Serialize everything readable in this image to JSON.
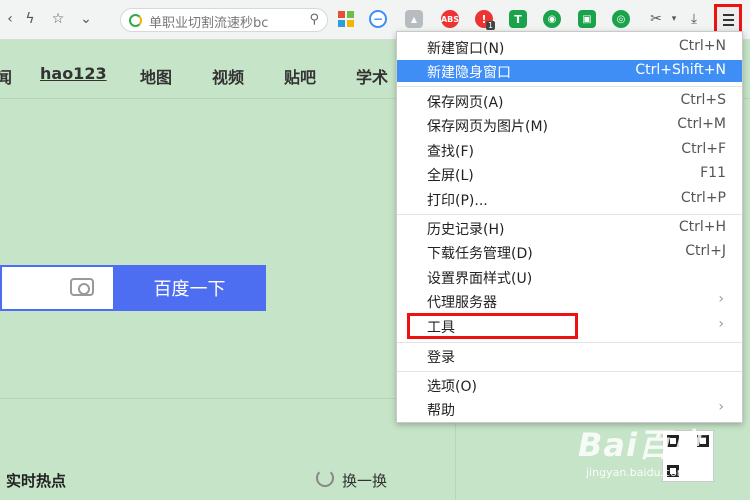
{
  "address_bar": {
    "text": "单职业切割流速秒bc"
  },
  "extensions": [
    {
      "name": "tile-grid-icon",
      "color": "#e94f35"
    },
    {
      "name": "minus-circle-icon",
      "color": "#3f8ef5"
    },
    {
      "name": "puzzle-icon",
      "color": "#9aa0a6"
    },
    {
      "name": "abs-icon",
      "label": "ABS",
      "color": "#e33"
    },
    {
      "name": "alert-icon",
      "color": "#e33",
      "badge": "1"
    },
    {
      "name": "t-shield-icon",
      "label": "T",
      "color": "#1aa34a"
    },
    {
      "name": "eye-icon",
      "color": "#1aa34a"
    },
    {
      "name": "image-icon",
      "color": "#1aa34a"
    },
    {
      "name": "rss-icon",
      "color": "#1aa34a"
    }
  ],
  "nav": [
    "闻",
    "hao123",
    "地图",
    "视频",
    "贴吧",
    "学术"
  ],
  "search": {
    "button_label": "百度一下"
  },
  "hot": {
    "title": "实时热点",
    "refresh_label": "换一换"
  },
  "watermark": {
    "main": "Bai百度",
    "sub": "jingyan.baidu.com"
  },
  "menu": {
    "items": [
      {
        "label": "新建窗口(N)",
        "shortcut": "Ctrl+N"
      },
      {
        "label": "新建隐身窗口",
        "shortcut": "Ctrl+Shift+N",
        "highlighted": true
      },
      {
        "label": "保存网页(A)",
        "shortcut": "Ctrl+S"
      },
      {
        "label": "保存网页为图片(M)",
        "shortcut": "Ctrl+M"
      },
      {
        "label": "查找(F)",
        "shortcut": "Ctrl+F"
      },
      {
        "label": "全屏(L)",
        "shortcut": "F11"
      },
      {
        "label": "打印(P)...",
        "shortcut": "Ctrl+P"
      },
      {
        "label": "历史记录(H)",
        "shortcut": "Ctrl+H"
      },
      {
        "label": "下载任务管理(D)",
        "shortcut": "Ctrl+J"
      },
      {
        "label": "设置界面样式(U)",
        "shortcut": ""
      },
      {
        "label": "代理服务器",
        "submenu": true
      },
      {
        "label": "工具",
        "submenu": true
      },
      {
        "label": "登录",
        "shortcut": ""
      },
      {
        "label": "选项(O)",
        "shortcut": ""
      },
      {
        "label": "帮助",
        "submenu": true
      }
    ]
  }
}
